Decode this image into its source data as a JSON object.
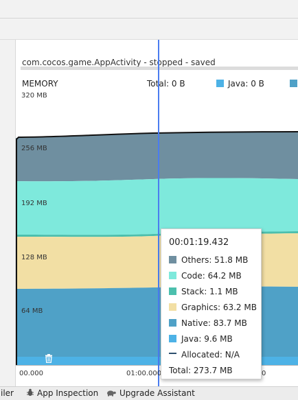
{
  "session": {
    "title": "com.cocos.game.AppActivity - stopped - saved"
  },
  "header": {
    "memory_label": "MEMORY",
    "total": "Total: 0 B",
    "java": "Java: 0 B"
  },
  "y_axis": [
    "320 MB",
    "256 MB",
    "192 MB",
    "128 MB",
    "64 MB"
  ],
  "x_axis": [
    "00.000",
    "01:00.000",
    "0"
  ],
  "tooltip": {
    "time": "00:01:19.432",
    "rows": [
      {
        "label": "Others: 51.8 MB",
        "color": "#6f8fa0"
      },
      {
        "label": "Code: 64.2 MB",
        "color": "#7ee9dc"
      },
      {
        "label": "Stack: 1.1 MB",
        "color": "#4cbfad"
      },
      {
        "label": "Graphics: 63.2 MB",
        "color": "#f2dfa4"
      },
      {
        "label": "Native: 83.7 MB",
        "color": "#4fa1c7"
      },
      {
        "label": "Java: 9.6 MB",
        "color": "#4db2e6"
      },
      {
        "label": "Allocated: N/A",
        "color": "#2c4f6e"
      }
    ],
    "total": "Total: 273.7 MB"
  },
  "bottom_bar": {
    "profiler_fragment": "iler",
    "app_inspection": "App Inspection",
    "upgrade_assistant": "Upgrade Assistant"
  },
  "colors": {
    "others": "#6f8fa0",
    "code": "#7ee9dc",
    "graphics": "#f2dfa4",
    "native": "#4fa1c7",
    "java": "#4db2e6",
    "cursor": "#4a7cf0"
  }
}
